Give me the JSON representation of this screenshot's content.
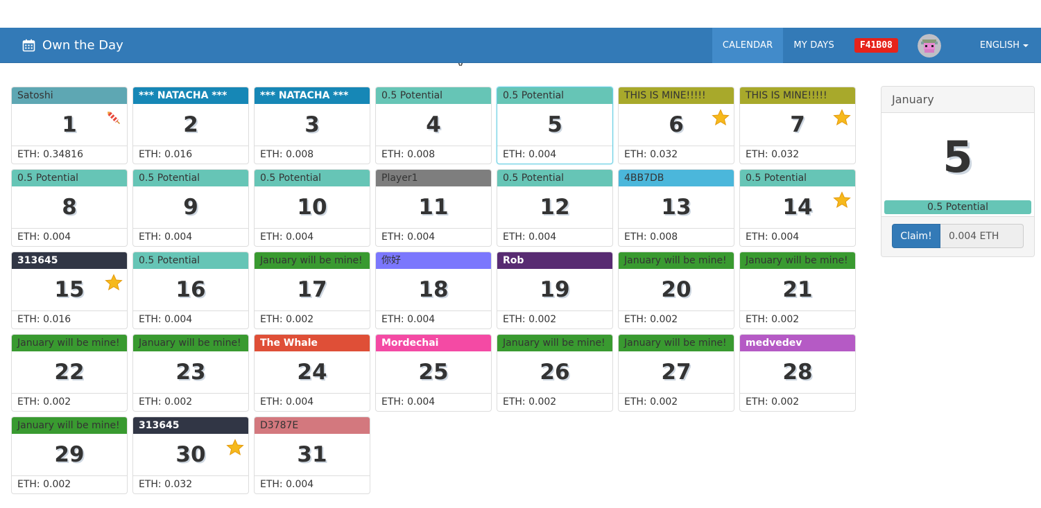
{
  "navbar": {
    "brand": "Own the Day",
    "brand_icon": "calendar-icon",
    "items": [
      "CALENDAR",
      "MY DAYS"
    ],
    "active_item": "CALENDAR",
    "account_code": "F41B08",
    "language": "ENGLISH"
  },
  "days": [
    {
      "num": "1",
      "owner": "Satoshi",
      "eth": "ETH: 0.34816",
      "color": "#5ea7b3",
      "text": "dark",
      "icon": "firecracker-icon"
    },
    {
      "num": "2",
      "owner": "*** NATACHA ***",
      "eth": "ETH: 0.016",
      "color": "#1687b6",
      "text": "light",
      "icon": ""
    },
    {
      "num": "3",
      "owner": "*** NATACHA ***",
      "eth": "ETH: 0.008",
      "color": "#1687b6",
      "text": "light",
      "icon": ""
    },
    {
      "num": "4",
      "owner": "0.5 Potential",
      "eth": "ETH: 0.008",
      "color": "#66c5b6",
      "text": "dark",
      "icon": ""
    },
    {
      "num": "5",
      "owner": "0.5 Potential",
      "eth": "ETH: 0.004",
      "color": "#66c5b6",
      "text": "dark",
      "icon": "",
      "selected": true
    },
    {
      "num": "6",
      "owner": "THIS IS MINE!!!!!",
      "eth": "ETH: 0.032",
      "color": "#a8a92b",
      "text": "dark",
      "icon": "star-icon"
    },
    {
      "num": "7",
      "owner": "THIS IS MINE!!!!!",
      "eth": "ETH: 0.032",
      "color": "#a8a92b",
      "text": "dark",
      "icon": "star-icon"
    },
    {
      "num": "8",
      "owner": "0.5 Potential",
      "eth": "ETH: 0.004",
      "color": "#66c5b6",
      "text": "dark",
      "icon": ""
    },
    {
      "num": "9",
      "owner": "0.5 Potential",
      "eth": "ETH: 0.004",
      "color": "#66c5b6",
      "text": "dark",
      "icon": ""
    },
    {
      "num": "10",
      "owner": "0.5 Potential",
      "eth": "ETH: 0.004",
      "color": "#66c5b6",
      "text": "dark",
      "icon": ""
    },
    {
      "num": "11",
      "owner": "Player1",
      "eth": "ETH: 0.004",
      "color": "#7e7e7e",
      "text": "dark",
      "icon": ""
    },
    {
      "num": "12",
      "owner": "0.5 Potential",
      "eth": "ETH: 0.004",
      "color": "#66c5b6",
      "text": "dark",
      "icon": ""
    },
    {
      "num": "13",
      "owner": "4BB7DB",
      "eth": "ETH: 0.008",
      "color": "#4bb7db",
      "text": "dark",
      "icon": ""
    },
    {
      "num": "14",
      "owner": "0.5 Potential",
      "eth": "ETH: 0.004",
      "color": "#66c5b6",
      "text": "dark",
      "icon": "star-icon"
    },
    {
      "num": "15",
      "owner": "313645",
      "eth": "ETH: 0.016",
      "color": "#313645",
      "text": "light",
      "icon": "star-icon"
    },
    {
      "num": "16",
      "owner": "0.5 Potential",
      "eth": "ETH: 0.004",
      "color": "#66c5b6",
      "text": "dark",
      "icon": ""
    },
    {
      "num": "17",
      "owner": "January will be mine!",
      "eth": "ETH: 0.002",
      "color": "#399a30",
      "text": "dark",
      "icon": ""
    },
    {
      "num": "18",
      "owner": "你好",
      "eth": "ETH: 0.004",
      "color": "#7b77fd",
      "text": "dark",
      "icon": ""
    },
    {
      "num": "19",
      "owner": "Rob",
      "eth": "ETH: 0.002",
      "color": "#582b72",
      "text": "light",
      "icon": ""
    },
    {
      "num": "20",
      "owner": "January will be mine!",
      "eth": "ETH: 0.002",
      "color": "#399a30",
      "text": "dark",
      "icon": ""
    },
    {
      "num": "21",
      "owner": "January will be mine!",
      "eth": "ETH: 0.002",
      "color": "#399a30",
      "text": "dark",
      "icon": ""
    },
    {
      "num": "22",
      "owner": "January will be mine!",
      "eth": "ETH: 0.002",
      "color": "#399a30",
      "text": "dark",
      "icon": ""
    },
    {
      "num": "23",
      "owner": "January will be mine!",
      "eth": "ETH: 0.002",
      "color": "#399a30",
      "text": "dark",
      "icon": ""
    },
    {
      "num": "24",
      "owner": "The Whale",
      "eth": "ETH: 0.004",
      "color": "#df4f37",
      "text": "light",
      "icon": ""
    },
    {
      "num": "25",
      "owner": "Mordechai",
      "eth": "ETH: 0.004",
      "color": "#f44aa4",
      "text": "light",
      "icon": ""
    },
    {
      "num": "26",
      "owner": "January will be mine!",
      "eth": "ETH: 0.002",
      "color": "#399a30",
      "text": "dark",
      "icon": ""
    },
    {
      "num": "27",
      "owner": "January will be mine!",
      "eth": "ETH: 0.002",
      "color": "#399a30",
      "text": "dark",
      "icon": ""
    },
    {
      "num": "28",
      "owner": "medvedev",
      "eth": "ETH: 0.002",
      "color": "#b55ac5",
      "text": "light",
      "icon": ""
    },
    {
      "num": "29",
      "owner": "January will be mine!",
      "eth": "ETH: 0.002",
      "color": "#399a30",
      "text": "dark",
      "icon": ""
    },
    {
      "num": "30",
      "owner": "313645",
      "eth": "ETH: 0.032",
      "color": "#313645",
      "text": "light",
      "icon": "star-icon"
    },
    {
      "num": "31",
      "owner": "D3787E",
      "eth": "ETH: 0.004",
      "color": "#d3787e",
      "text": "dark",
      "icon": ""
    }
  ],
  "detail": {
    "month": "January",
    "day": "5",
    "owner": "0.5 Potential",
    "owner_color": "#66c5b6",
    "claim_label": "Claim!",
    "price": "0.004 ETH"
  }
}
